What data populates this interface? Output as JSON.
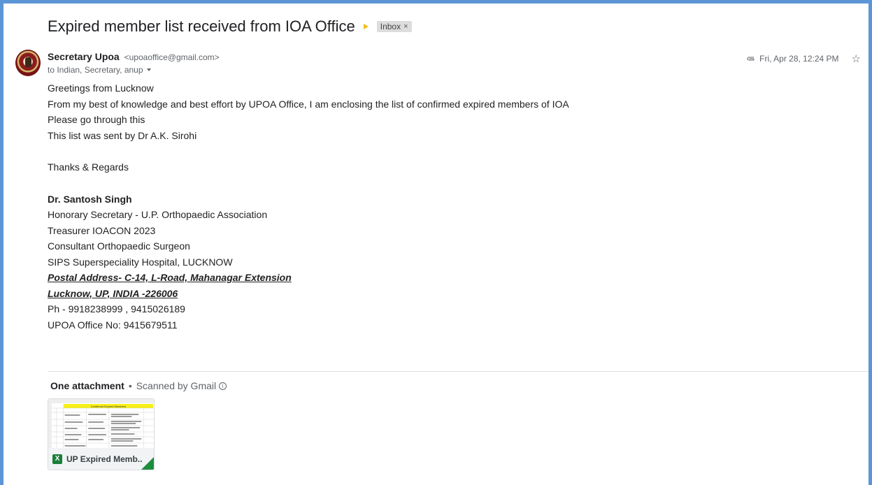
{
  "email": {
    "subject": "Expired member list received from IOA Office",
    "label": "Inbox",
    "label_close": "×",
    "sender": {
      "name": "Secretary Upoa",
      "email": "<upoaoffice@gmail.com>"
    },
    "recipients": "to Indian, Secretary, anup",
    "date": "Fri, Apr 28, 12:24 PM"
  },
  "body": {
    "lines": [
      "Greetings from Lucknow",
      "From my best of knowledge and best effort by UPOA Office, I am enclosing the list of confirmed expired members of IOA",
      "Please go through this",
      "This list was sent by Dr A.K. Sirohi"
    ],
    "regards": "Thanks & Regards",
    "signature": {
      "name": "Dr. Santosh Singh",
      "title1": "Honorary Secretary - U.P. Orthopaedic Association",
      "title2": "Treasurer IOACON 2023",
      "title3": "Consultant Orthopaedic Surgeon",
      "hospital": "SIPS Superspeciality Hospital, LUCKNOW",
      "address1": "Postal Address- C-14, L-Road, Mahanagar Extension ",
      "address2": "Lucknow, UP, INDIA -226006",
      "phone": "Ph - 9918238999 , 9415026189",
      "office": "UPOA Office No: 9415679511"
    }
  },
  "attachments": {
    "count_label": "One attachment",
    "separator": "•",
    "scan_label": "Scanned by Gmail",
    "items": [
      {
        "name": "UP Expired Memb...",
        "type_badge": "X",
        "preview_title": "Confirmed Expired Members"
      }
    ]
  },
  "icons": {
    "importance": "importance-marker-icon",
    "clip": "paperclip-icon",
    "star": "star-icon",
    "info": "info-icon"
  },
  "colors": {
    "frame_border": "#5b95d6",
    "importance": "#f2c01d",
    "xls_green": "#188038"
  }
}
